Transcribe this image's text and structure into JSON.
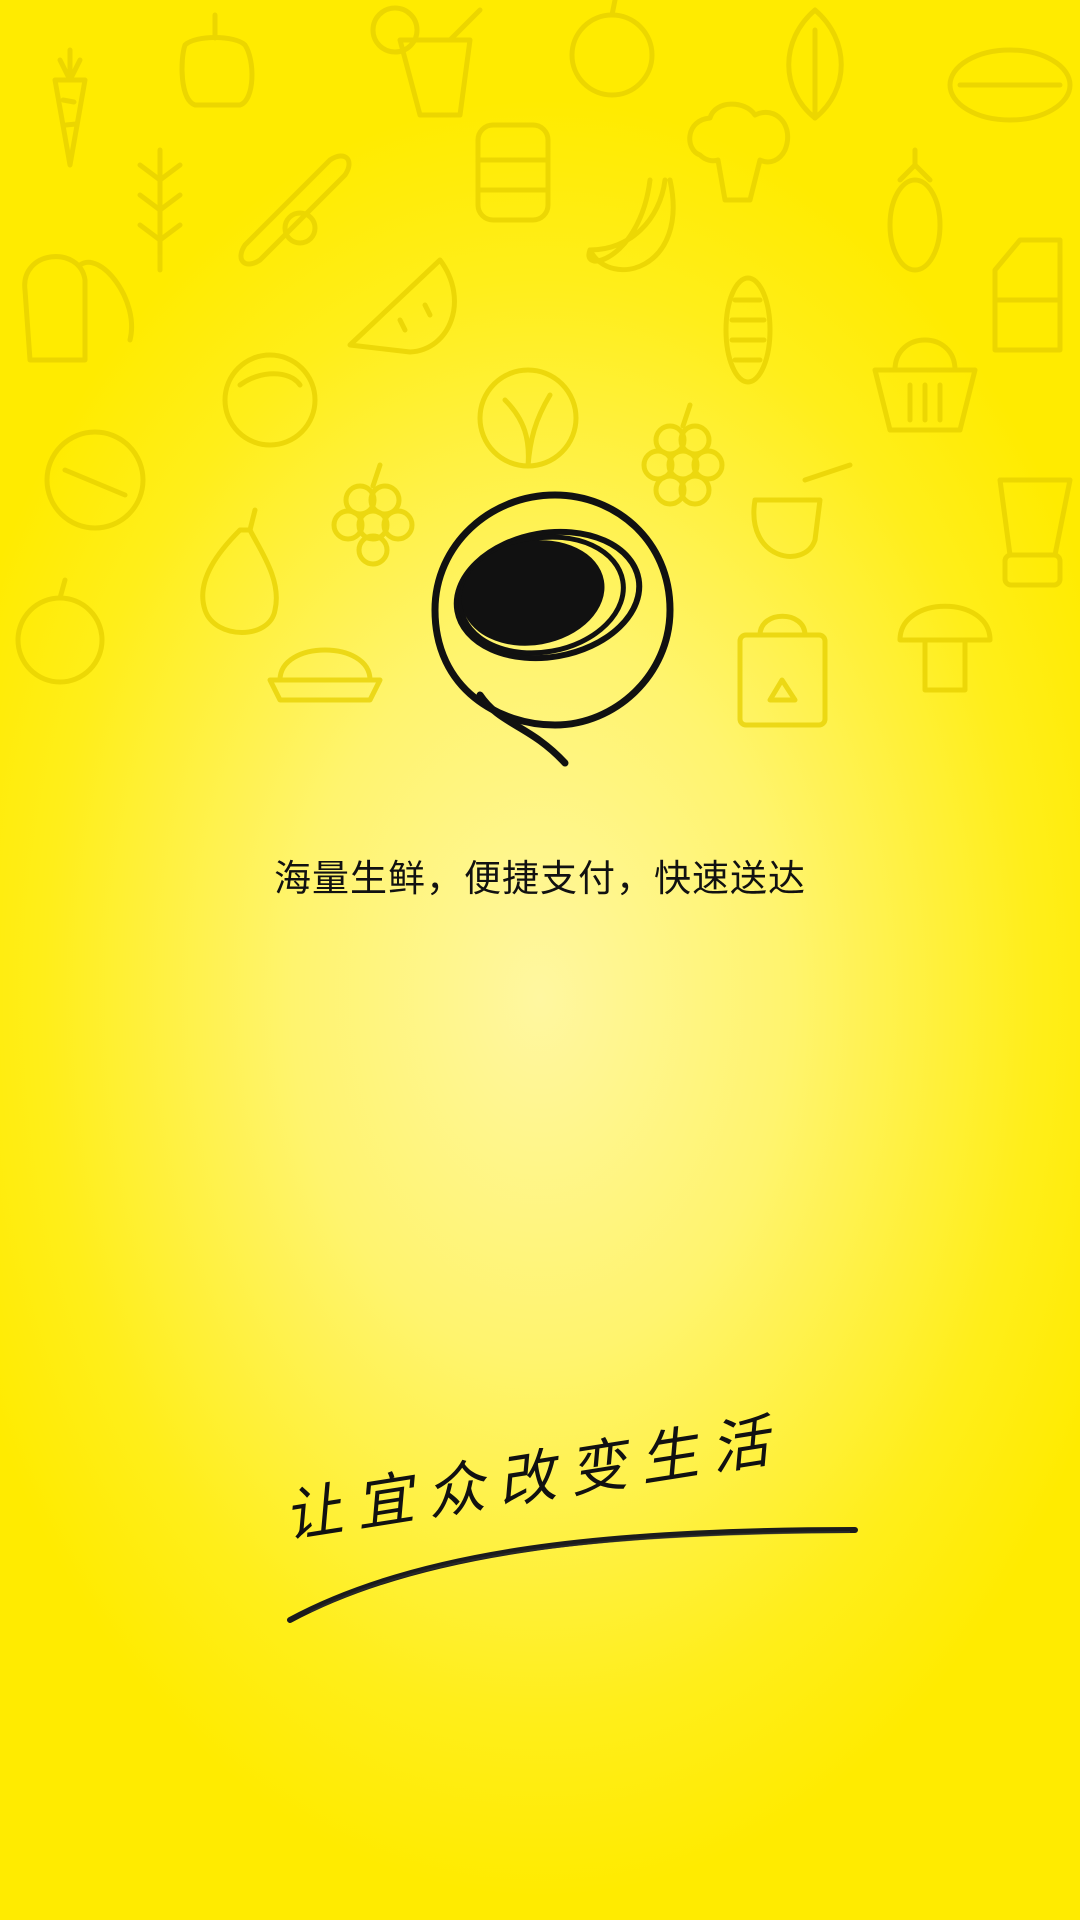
{
  "splash": {
    "tagline": "海量生鲜，便捷支付，快速送达",
    "slogan": "让宜众改变生活"
  },
  "logo": {
    "icon": "coconut-swirl-logo-icon"
  },
  "background": {
    "icons": [
      "carrot-icon",
      "pepper-icon",
      "juice-icon",
      "apple-icon",
      "leaf-icon",
      "lemon-icon",
      "wheat-icon",
      "cucumber-icon",
      "jar-icon",
      "broccoli-icon",
      "banana-icon",
      "eggplant-icon",
      "bread-icon",
      "watermelon-icon",
      "corn-icon",
      "milk-carton-icon",
      "tomato-icon",
      "cabbage-icon",
      "grapes-icon",
      "basket-icon",
      "orange-icon",
      "honey-icon",
      "blender-icon",
      "pear-icon",
      "juicer-icon",
      "shopping-bag-icon",
      "mushroom-icon"
    ],
    "colors": {
      "primary": "#ffeb00",
      "center": "#fff7a0",
      "icon_stroke": "#e6d000",
      "ink": "#111111"
    }
  }
}
